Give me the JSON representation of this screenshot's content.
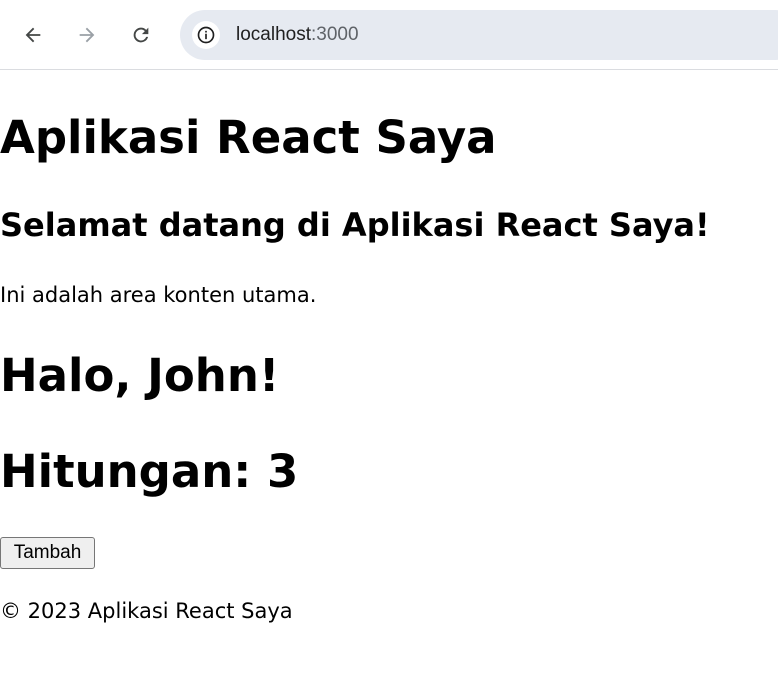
{
  "browser": {
    "url_host": "localhost",
    "url_port": ":3000",
    "icons": {
      "back": "arrow-left-icon",
      "forward": "arrow-right-icon",
      "reload": "reload-icon",
      "site_info": "info-icon"
    }
  },
  "app": {
    "title": "Aplikasi React Saya",
    "welcome": "Selamat datang di Aplikasi React Saya!",
    "main_text": "Ini adalah area konten utama.",
    "greeting": "Halo, John!",
    "counter_text": "Hitungan: 3",
    "add_button_label": "Tambah",
    "footer_text": "© 2023 Aplikasi React Saya"
  }
}
